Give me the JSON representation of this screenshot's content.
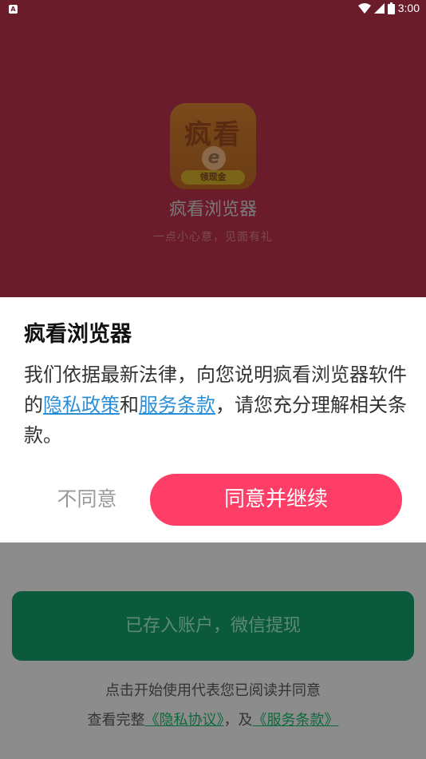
{
  "status_bar": {
    "notification_icon": "A",
    "time": "3:00",
    "icons": [
      "wifi-icon",
      "signal-icon",
      "battery-icon"
    ]
  },
  "app": {
    "icon_text": "疯看",
    "icon_e": "e",
    "icon_badge": "领现金",
    "name": "疯看浏览器",
    "tagline": "一点小心意，见面有礼"
  },
  "dialog": {
    "title": "疯看浏览器",
    "body_prefix": "我们依据最新法律，向您说明疯看浏览器软件的",
    "privacy_link": "隐私政策",
    "and": "和",
    "terms_link": "服务条款",
    "body_suffix": "，请您充分理解相关条款。",
    "disagree_label": "不同意",
    "agree_label": "同意并继续"
  },
  "background": {
    "green_button_label": "已存入账户，微信提现",
    "note_line1": "点击开始使用代表您已阅读并同意",
    "note_line2_prefix": "查看完整",
    "note_privacy_link": "《隐私协议》",
    "note_sep": "，及",
    "note_terms_link": "《服务条款》"
  },
  "colors": {
    "overlay_top": "#6b1c2a",
    "agree_button": "#ff3e68",
    "link": "#2a8fd6",
    "green_button": "#0b5a3c"
  }
}
